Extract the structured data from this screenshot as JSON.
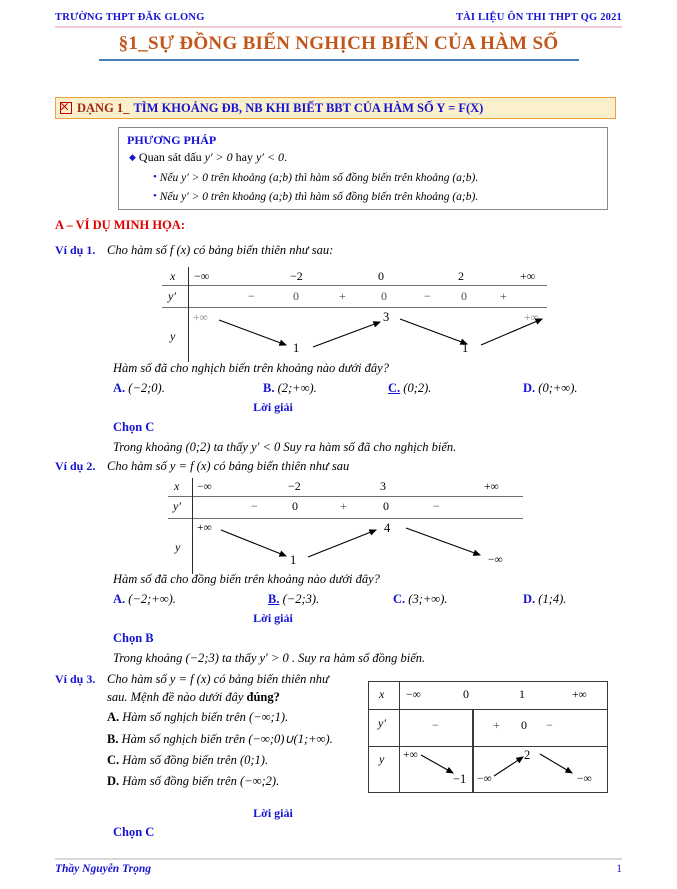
{
  "header": {
    "left": "TRƯỜNG THPT ĐĂK GLONG",
    "right": "TÀI LIỆU ÔN THI THPT QG 2021"
  },
  "title": "§1_SỰ ĐỒNG BIẾN NGHỊCH BIẾN CỦA HÀM SỐ",
  "dang": {
    "icon": "boxed-x-icon",
    "label": "DẠNG 1_",
    "text": "TÌM KHOẢNG ĐB, NB KHI BIẾT BBT CỦA HÀM SỐ Y = F(X)"
  },
  "method": {
    "title": "PHƯƠNG PHÁP",
    "line1": "Quan sát dấu",
    "line1_m1": "y′ > 0",
    "line1_mid": "hay",
    "line1_m2": "y′ < 0",
    "line1_end": ".",
    "line2": "Nếu  y′ > 0  trên khoảng (a;b)  thì hàm số đồng biến trên khoảng (a;b).",
    "line3": "Nếu  y′ > 0  trên khoảng (a;b)  thì hàm số đồng biến trên khoảng (a;b)."
  },
  "section_a": "A – VÍ DỤ MINH HỌA:",
  "examples": [
    {
      "label": "Ví dụ 1.",
      "prompt": "Cho hàm số  f (x)  có bảng biến thiên như sau:",
      "question": "Hàm số đã cho nghịch biến trên khoảng nào dưới đây?",
      "options": [
        {
          "key": "A.",
          "text": "(−2;0).",
          "correct": false
        },
        {
          "key": "B.",
          "text": "(2;+∞).",
          "correct": false
        },
        {
          "key": "C.",
          "text": "(0;2).",
          "correct": true
        },
        {
          "key": "D.",
          "text": "(0;+∞).",
          "correct": false
        }
      ],
      "solution_label": "Lời giải",
      "choice": "Chọn C",
      "explanation": "Trong khoảng (0;2) ta thấy  y′ < 0  Suy ra hàm số đã cho nghịch biến."
    },
    {
      "label": "Ví dụ 2.",
      "prompt": "Cho hàm số  y = f (x)  có bảng biến thiên như sau",
      "question": "Hàm số đã cho đồng biến trên khoảng nào dưới đây?",
      "options": [
        {
          "key": "A.",
          "text": "(−2;+∞).",
          "correct": false
        },
        {
          "key": "B.",
          "text": "(−2;3).",
          "correct": true
        },
        {
          "key": "C.",
          "text": "(3;+∞).",
          "correct": false
        },
        {
          "key": "D.",
          "text": "(1;4).",
          "correct": false
        }
      ],
      "solution_label": "Lời giải",
      "choice": "Chọn B",
      "explanation": "Trong khoảng (−2;3) ta thấy  y′ > 0 . Suy ra hàm số đồng biến."
    },
    {
      "label": "Ví dụ 3.",
      "prompt_line1": "Cho hàm số  y = f (x)  có bảng biến thiên như",
      "prompt_line2_a": "sau. Mệnh đề nào dưới đây ",
      "prompt_line2_b": "đúng?",
      "options": [
        {
          "key": "A.",
          "text": "Hàm số nghịch biến trên (−∞;1).",
          "correct": false
        },
        {
          "key": "B.",
          "text": "Hàm số nghịch biến trên (−∞;0)∪(1;+∞).",
          "correct": false
        },
        {
          "key": "C.",
          "text": "Hàm số đồng biến trên (0;1).",
          "correct": true
        },
        {
          "key": "D.",
          "text": "Hàm số đồng biến trên (−∞;2).",
          "correct": false
        }
      ],
      "solution_label": "Lời giải",
      "choice": "Chọn C"
    }
  ],
  "chart_data": [
    {
      "type": "table",
      "name": "bang-bien-thien-1",
      "row_labels": [
        "x",
        "y′",
        "y"
      ],
      "x_values": [
        "−∞",
        "−2",
        "0",
        "2",
        "+∞"
      ],
      "yprime_signs": [
        "−",
        "0",
        "+",
        "0",
        "−",
        "0",
        "+"
      ],
      "y_values": [
        "+∞",
        "1",
        "3",
        "1",
        "+∞"
      ],
      "y_directions": [
        "down",
        "up",
        "down",
        "up"
      ]
    },
    {
      "type": "table",
      "name": "bang-bien-thien-2",
      "row_labels": [
        "x",
        "y′",
        "y"
      ],
      "x_values": [
        "−∞",
        "−2",
        "3",
        "+∞"
      ],
      "yprime_signs": [
        "−",
        "0",
        "+",
        "0",
        "−"
      ],
      "y_values": [
        "+∞",
        "1",
        "4",
        "−∞"
      ],
      "y_directions": [
        "down",
        "up",
        "down"
      ]
    },
    {
      "type": "table",
      "name": "bang-bien-thien-3",
      "row_labels": [
        "x",
        "y′",
        "y"
      ],
      "x_values": [
        "−∞",
        "0",
        "1",
        "+∞"
      ],
      "yprime_signs": [
        "−",
        "+",
        "0",
        "−"
      ],
      "y_values": [
        "+∞",
        "−1",
        "−∞",
        "2",
        "−∞"
      ],
      "y_directions": [
        "down",
        "up",
        "down"
      ]
    }
  ],
  "footer": {
    "author": "Thầy Nguyễn Trọng",
    "page": "1"
  }
}
